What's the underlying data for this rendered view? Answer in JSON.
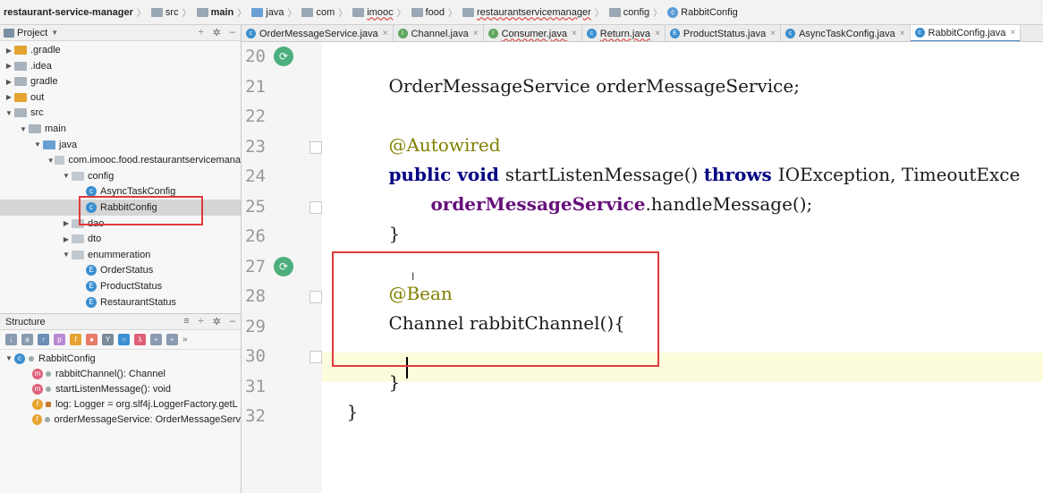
{
  "breadcrumb": [
    {
      "label": "restaurant-service-manager",
      "kind": "project"
    },
    {
      "label": "src",
      "kind": "folder"
    },
    {
      "label": "main",
      "kind": "folder"
    },
    {
      "label": "java",
      "kind": "folder"
    },
    {
      "label": "com",
      "kind": "folder"
    },
    {
      "label": "imooc",
      "kind": "folder"
    },
    {
      "label": "food",
      "kind": "folder"
    },
    {
      "label": "restaurantservicemanager",
      "kind": "folder"
    },
    {
      "label": "config",
      "kind": "folder"
    },
    {
      "label": "RabbitConfig",
      "kind": "class"
    }
  ],
  "project_panel": {
    "title": "Project",
    "tree": [
      {
        "label": ".gradle",
        "indent": 0,
        "arrow": "▶",
        "icon": "folder-orange"
      },
      {
        "label": ".idea",
        "indent": 0,
        "arrow": "▶",
        "icon": "folder-gray"
      },
      {
        "label": "gradle",
        "indent": 0,
        "arrow": "▶",
        "icon": "folder-gray"
      },
      {
        "label": "out",
        "indent": 0,
        "arrow": "▶",
        "icon": "folder-orange"
      },
      {
        "label": "src",
        "indent": 0,
        "arrow": "▼",
        "icon": "folder-gray"
      },
      {
        "label": "main",
        "indent": 1,
        "arrow": "▼",
        "icon": "folder-gray"
      },
      {
        "label": "java",
        "indent": 2,
        "arrow": "▼",
        "icon": "folder-blue"
      },
      {
        "label": "com.imooc.food.restaurantservicemana",
        "indent": 3,
        "arrow": "▼",
        "icon": "folder-pkg"
      },
      {
        "label": "config",
        "indent": 4,
        "arrow": "▼",
        "icon": "folder-pkg"
      },
      {
        "label": "AsyncTaskConfig",
        "indent": 5,
        "arrow": "",
        "icon": "class"
      },
      {
        "label": "RabbitConfig",
        "indent": 5,
        "arrow": "",
        "icon": "class",
        "selected": true
      },
      {
        "label": "dao",
        "indent": 4,
        "arrow": "▶",
        "icon": "folder-pkg"
      },
      {
        "label": "dto",
        "indent": 4,
        "arrow": "▶",
        "icon": "folder-pkg"
      },
      {
        "label": "enummeration",
        "indent": 4,
        "arrow": "▼",
        "icon": "folder-pkg"
      },
      {
        "label": "OrderStatus",
        "indent": 5,
        "arrow": "",
        "icon": "enum"
      },
      {
        "label": "ProductStatus",
        "indent": 5,
        "arrow": "",
        "icon": "enum"
      },
      {
        "label": "RestaurantStatus",
        "indent": 5,
        "arrow": "",
        "icon": "enum"
      }
    ]
  },
  "structure_panel": {
    "title": "Structure",
    "root": "RabbitConfig",
    "members": [
      {
        "label": "rabbitChannel(): Channel",
        "icon": "m"
      },
      {
        "label": "startListenMessage(): void",
        "icon": "m"
      },
      {
        "label": "log: Logger = org.slf4j.LoggerFactory.getL",
        "icon": "f-static"
      },
      {
        "label": "orderMessageService: OrderMessageServ",
        "icon": "f"
      }
    ]
  },
  "tabs": [
    {
      "label": "OrderMessageService.java",
      "icon": "c"
    },
    {
      "label": "Channel.java",
      "icon": "i"
    },
    {
      "label": "Consumer.java",
      "icon": "i"
    },
    {
      "label": "Return.java",
      "icon": "c"
    },
    {
      "label": "ProductStatus.java",
      "icon": "e"
    },
    {
      "label": "AsyncTaskConfig.java",
      "icon": "c"
    },
    {
      "label": "RabbitConfig.java",
      "icon": "c",
      "active": true
    }
  ],
  "editor": {
    "line_numbers": [
      "20",
      "21",
      "22",
      "23",
      "24",
      "25",
      "26",
      "27",
      "28",
      "29",
      "30",
      "31",
      "32"
    ],
    "lines": {
      "l20": "OrderMessageService orderMessageService;",
      "l22": "@Autowired",
      "l23_kw1": "public void ",
      "l23_m": "startListenMessage() ",
      "l23_kw2": "throws ",
      "l23_rest": "IOException, TimeoutExce",
      "l24_fld": "orderMessageService",
      "l24_rest": ".handleMessage();",
      "l25": "}",
      "l27": "@Bean",
      "l28": "Channel rabbitChannel(){",
      "l30": "}",
      "l31": "}"
    }
  }
}
